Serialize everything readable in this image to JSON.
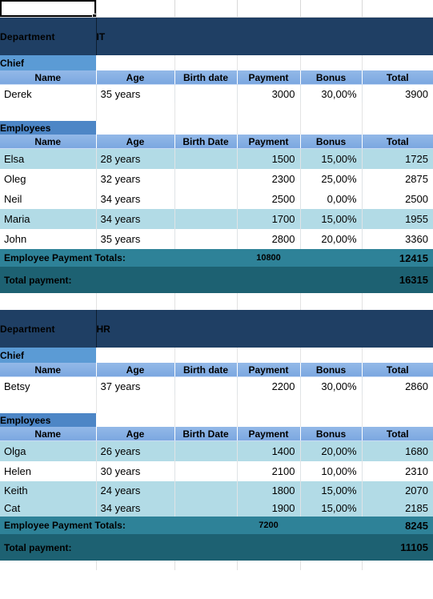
{
  "app": {
    "type": "spreadsheet",
    "selected_cell_value": ""
  },
  "labels": {
    "department": "Department",
    "chief": "Chief",
    "employees": "Employees",
    "employee_totals": "Employee Payment Totals:",
    "total_payment": "Total payment:"
  },
  "columns": {
    "chief_headers": [
      "Name",
      "Age",
      "Birth date",
      "Payment",
      "Bonus",
      "Total"
    ],
    "employee_headers": [
      "Name",
      "Age",
      "Birth Date",
      "Payment",
      "Bonus",
      "Total"
    ]
  },
  "colors": {
    "department_band": "#1f3f64",
    "chief_band": "#5b9bd5",
    "employees_band": "#4d86c6",
    "column_header": "#82aee4",
    "row_highlight": "#b2dbe6",
    "totals_band": "#2e8298",
    "grand_total_band": "#1d6172"
  },
  "departments": [
    {
      "name": "IT",
      "chief": {
        "name": "Derek",
        "age": "35 years",
        "birth_date": "",
        "payment": "3000",
        "bonus": "30,00%",
        "total": "3900"
      },
      "employees": [
        {
          "name": "Elsa",
          "age": "28 years",
          "birth_date": "",
          "payment": "1500",
          "bonus": "15,00%",
          "total": "1725"
        },
        {
          "name": "Oleg",
          "age": "32 years",
          "birth_date": "",
          "payment": "2300",
          "bonus": "25,00%",
          "total": "2875"
        },
        {
          "name": "Neil",
          "age": "34 years",
          "birth_date": "",
          "payment": "2500",
          "bonus": "0,00%",
          "total": "2500"
        },
        {
          "name": "Maria",
          "age": "34 years",
          "birth_date": "",
          "payment": "1700",
          "bonus": "15,00%",
          "total": "1955"
        },
        {
          "name": "John",
          "age": "35 years",
          "birth_date": "",
          "payment": "2800",
          "bonus": "20,00%",
          "total": "3360"
        }
      ],
      "employee_totals": {
        "payment": "10800",
        "total": "12415"
      },
      "total_payment": "16315"
    },
    {
      "name": "HR",
      "chief": {
        "name": "Betsy",
        "age": "37 years",
        "birth_date": "",
        "payment": "2200",
        "bonus": "30,00%",
        "total": "2860"
      },
      "employees": [
        {
          "name": "Olga",
          "age": "26 years",
          "birth_date": "",
          "payment": "1400",
          "bonus": "20,00%",
          "total": "1680"
        },
        {
          "name": "Helen",
          "age": "30 years",
          "birth_date": "",
          "payment": "2100",
          "bonus": "10,00%",
          "total": "2310"
        },
        {
          "name": "Keith",
          "age": "24 years",
          "birth_date": "",
          "payment": "1800",
          "bonus": "15,00%",
          "total": "2070"
        },
        {
          "name": "Cat",
          "age": "34 years",
          "birth_date": "",
          "payment": "1900",
          "bonus": "15,00%",
          "total": "2185"
        }
      ],
      "employee_totals": {
        "payment": "7200",
        "total": "8245"
      },
      "total_payment": "11105"
    }
  ]
}
